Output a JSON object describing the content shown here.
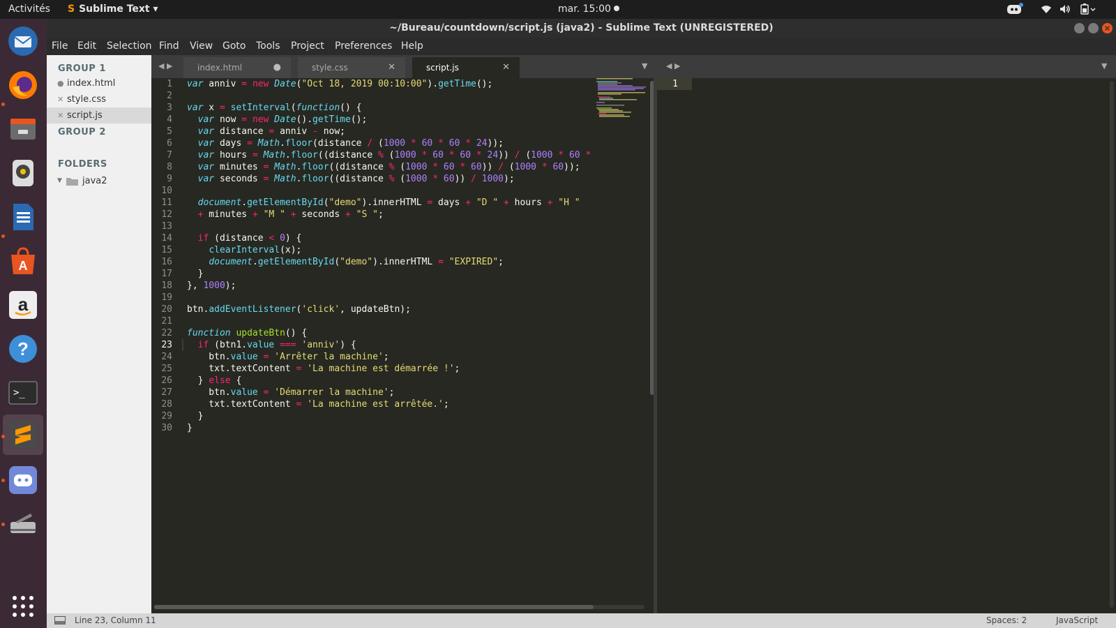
{
  "topbar": {
    "activities": "Activités",
    "app_menu": "Sublime Text",
    "clock": "mar. 15:00"
  },
  "dock": {
    "items": [
      "thunderbird-icon",
      "firefox-icon",
      "files-icon",
      "rhythmbox-icon",
      "writer-icon",
      "software-icon",
      "amazon-icon",
      "help-icon",
      "terminal-icon",
      "sublime-text-icon",
      "discord-icon",
      "scanner-icon",
      "app-grid-icon"
    ]
  },
  "window": {
    "title": "~/Bureau/countdown/script.js (java2) - Sublime Text (UNREGISTERED)"
  },
  "menu": [
    "File",
    "Edit",
    "Selection",
    "Find",
    "View",
    "Goto",
    "Tools",
    "Project",
    "Preferences",
    "Help"
  ],
  "sidebar": {
    "group1": "GROUP 1",
    "files": [
      {
        "name": "index.html",
        "marker": "●"
      },
      {
        "name": "style.css",
        "marker": "✕"
      },
      {
        "name": "script.js",
        "marker": "✕"
      }
    ],
    "group2": "GROUP 2",
    "folders_label": "FOLDERS",
    "folder": "java2"
  },
  "tabs": [
    {
      "label": "index.html",
      "close": "●"
    },
    {
      "label": "style.css",
      "close": "✕"
    },
    {
      "label": "script.js",
      "close": "✕"
    }
  ],
  "editor": {
    "current_line": 23,
    "line_numbers": [
      "1",
      "2",
      "3",
      "4",
      "5",
      "6",
      "7",
      "8",
      "9",
      "10",
      "11",
      "12",
      "13",
      "14",
      "15",
      "16",
      "17",
      "18",
      "19",
      "20",
      "21",
      "22",
      "23",
      "24",
      "25",
      "26",
      "27",
      "28",
      "29",
      "30"
    ]
  },
  "pane2": {
    "line_number": "1"
  },
  "status": {
    "position": "Line 23, Column 11",
    "spaces": "Spaces: 2",
    "syntax": "JavaScript"
  },
  "colors": {
    "background": "#272822",
    "keyword": "#f92672",
    "string": "#e6db74",
    "number": "#ae81ff",
    "function": "#66d9ef",
    "name": "#a6e22e"
  }
}
